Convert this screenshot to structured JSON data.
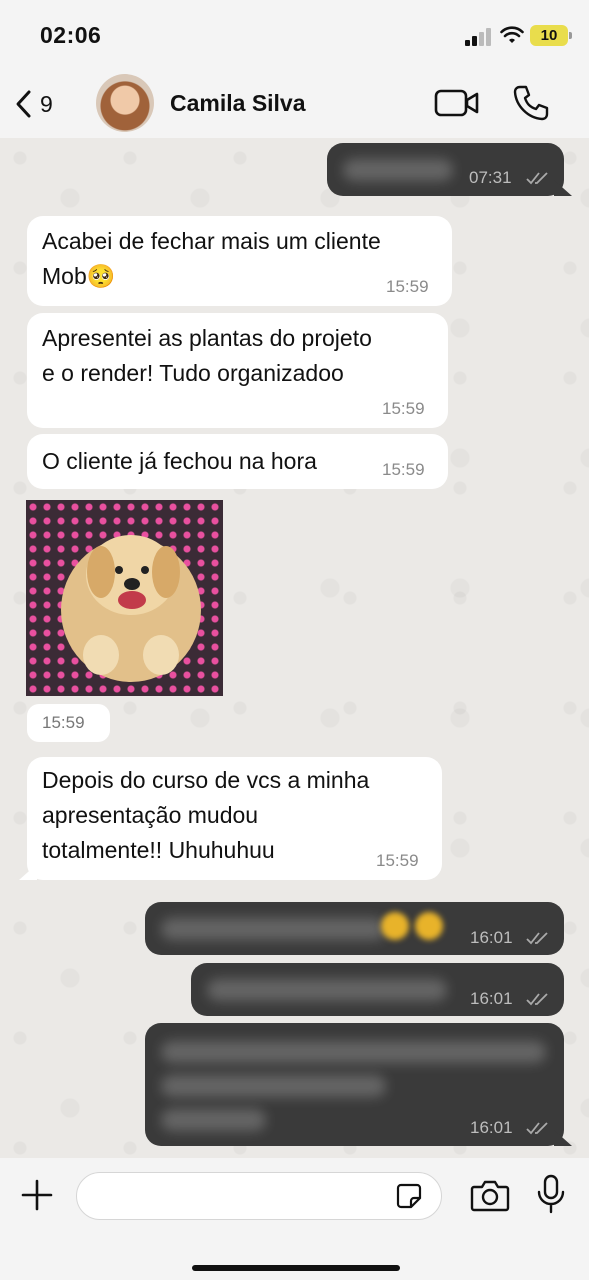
{
  "status": {
    "time": "02:06",
    "battery": "10"
  },
  "header": {
    "back_count": "9",
    "contact_name": "Camila Silva"
  },
  "messages": [
    {
      "dir": "out",
      "text": "",
      "time": "07:31"
    },
    {
      "dir": "in",
      "line1": "Acabei de fechar mais um cliente",
      "line2": "Mob🥺",
      "time": "15:59"
    },
    {
      "dir": "in",
      "line1": "Apresentei as plantas do projeto",
      "line2": "e o render! Tudo organizadoo",
      "time": "15:59"
    },
    {
      "dir": "in",
      "line1": "O cliente já fechou na hora",
      "time": "15:59"
    },
    {
      "dir": "in",
      "type": "image",
      "time": "15:59"
    },
    {
      "dir": "in",
      "line1": "Depois do curso de vcs a minha",
      "line2": "apresentação mudou",
      "line3": "totalmente!! Uhuhuhuu",
      "time": "15:59"
    },
    {
      "dir": "out",
      "text": "",
      "time": "16:01"
    },
    {
      "dir": "out",
      "text": "",
      "time": "16:01"
    },
    {
      "dir": "out",
      "text": "",
      "time": "16:01"
    }
  ],
  "composer": {
    "placeholder": ""
  }
}
